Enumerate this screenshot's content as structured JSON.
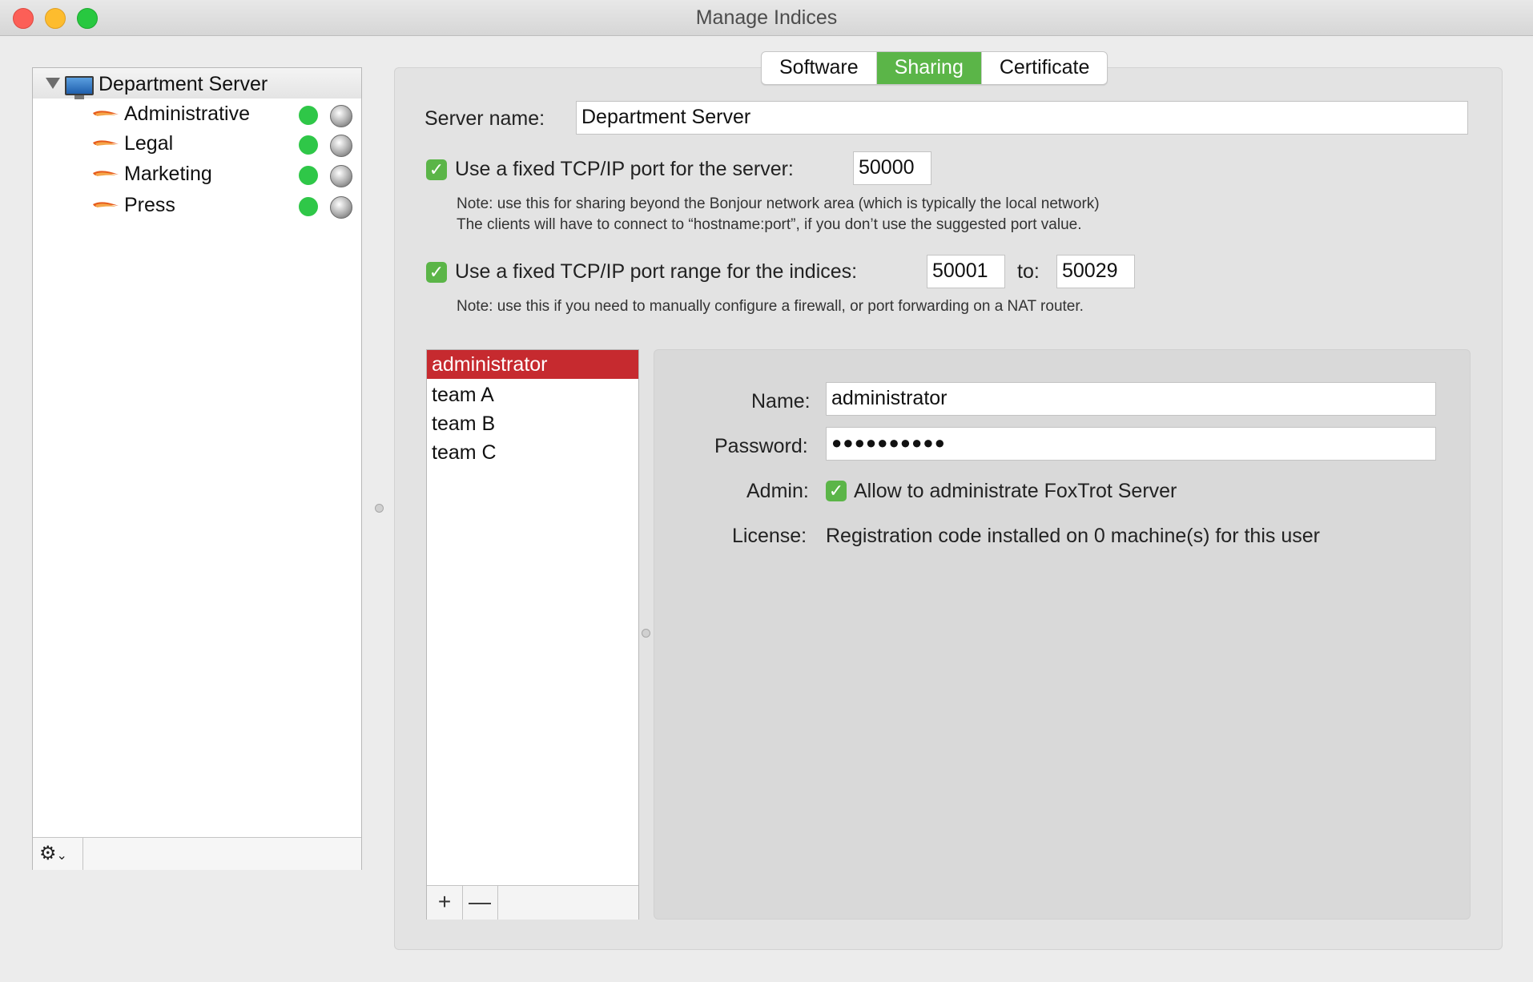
{
  "window": {
    "title": "Manage Indices"
  },
  "sidebar": {
    "root": {
      "label": "Department Server"
    },
    "items": [
      {
        "label": "Administrative"
      },
      {
        "label": "Legal"
      },
      {
        "label": "Marketing"
      },
      {
        "label": "Press"
      }
    ],
    "status_color": "#2fc748"
  },
  "tabs": [
    {
      "label": "Software",
      "active": false
    },
    {
      "label": "Sharing",
      "active": true
    },
    {
      "label": "Certificate",
      "active": false
    }
  ],
  "accent_color": "#5bb548",
  "sharing": {
    "server_name_label": "Server name:",
    "server_name_value": "Department Server",
    "fixed_port_label": "Use a fixed TCP/IP port for the server:",
    "fixed_port_checked": true,
    "fixed_port_value": "50000",
    "fixed_port_note_line1": "Note: use this for sharing beyond the Bonjour network area (which is typically the local network)",
    "fixed_port_note_line2": "The clients will have to connect to “hostname:port”, if you don’t use the suggested port value.",
    "port_range_label": "Use a fixed TCP/IP port range for the indices:",
    "port_range_checked": true,
    "port_range_from": "50001",
    "port_range_to_label": "to:",
    "port_range_to": "50029",
    "port_range_note": "Note: use this if you need to manually configure a firewall, or port forwarding on a NAT router."
  },
  "users": {
    "items": [
      {
        "label": "administrator",
        "selected": true
      },
      {
        "label": "team A",
        "selected": false
      },
      {
        "label": "team B",
        "selected": false
      },
      {
        "label": "team C",
        "selected": false
      }
    ],
    "selected_color": "#c62a2f",
    "add_label": "+",
    "remove_label": "—"
  },
  "user_details": {
    "name_label": "Name:",
    "name_value": "administrator",
    "password_label": "Password:",
    "password_value": "●●●●●●●●●●",
    "admin_label": "Admin:",
    "admin_checked": true,
    "admin_text": "Allow to administrate FoxTrot Server",
    "license_label": "License:",
    "license_text": "Registration code installed on 0 machine(s) for this user"
  },
  "icons": {
    "gear": "⚙",
    "chevron": "⌄",
    "check": "✓"
  }
}
